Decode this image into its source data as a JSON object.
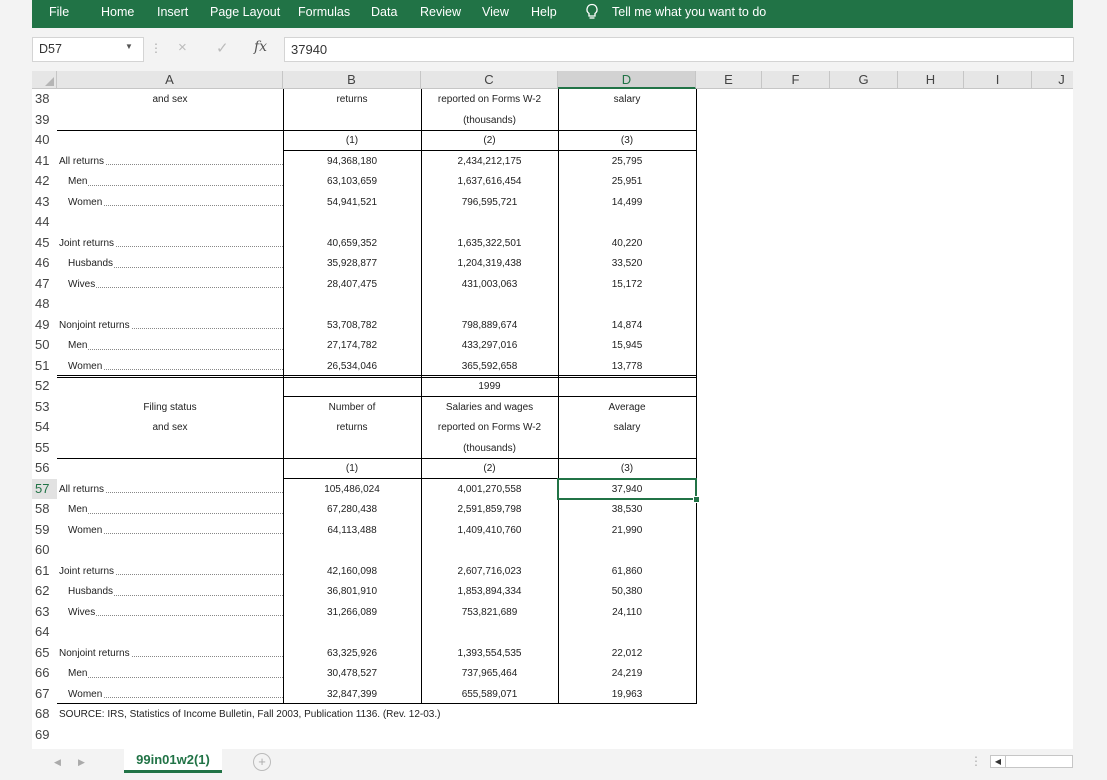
{
  "ribbon": {
    "tabs": [
      "File",
      "Home",
      "Insert",
      "Page Layout",
      "Formulas",
      "Data",
      "Review",
      "View",
      "Help"
    ],
    "tell_me": "Tell me what you want to do"
  },
  "formula_bar": {
    "name_box": "D57",
    "cancel_icon": "×",
    "enter_icon": "✓",
    "fx_label": "fx",
    "value": "37940"
  },
  "columns": [
    "A",
    "B",
    "C",
    "D",
    "E",
    "F",
    "G",
    "H",
    "I",
    "J"
  ],
  "selected_column": "D",
  "selected_row": "57",
  "rows": [
    {
      "n": "38",
      "a": "and sex",
      "b": "returns",
      "c": "reported on Forms W-2",
      "d": "salary"
    },
    {
      "n": "39",
      "a": "",
      "b": "",
      "c": "(thousands)",
      "d": ""
    },
    {
      "n": "40",
      "a": "",
      "b": "(1)",
      "c": "(2)",
      "d": "(3)"
    },
    {
      "n": "41",
      "a": "All returns",
      "b": "94,368,180",
      "c": "2,434,212,175",
      "d": "25,795"
    },
    {
      "n": "42",
      "a": "Men",
      "b": "63,103,659",
      "c": "1,637,616,454",
      "d": "25,951"
    },
    {
      "n": "43",
      "a": "Women",
      "b": "54,941,521",
      "c": "796,595,721",
      "d": "14,499"
    },
    {
      "n": "44",
      "a": "",
      "b": "",
      "c": "",
      "d": ""
    },
    {
      "n": "45",
      "a": "Joint returns",
      "b": "40,659,352",
      "c": "1,635,322,501",
      "d": "40,220"
    },
    {
      "n": "46",
      "a": "Husbands",
      "b": "35,928,877",
      "c": "1,204,319,438",
      "d": "33,520"
    },
    {
      "n": "47",
      "a": "Wives",
      "b": "28,407,475",
      "c": "431,003,063",
      "d": "15,172"
    },
    {
      "n": "48",
      "a": "",
      "b": "",
      "c": "",
      "d": ""
    },
    {
      "n": "49",
      "a": "Nonjoint returns",
      "b": "53,708,782",
      "c": "798,889,674",
      "d": "14,874"
    },
    {
      "n": "50",
      "a": "Men",
      "b": "27,174,782",
      "c": "433,297,016",
      "d": "15,945"
    },
    {
      "n": "51",
      "a": "Women",
      "b": "26,534,046",
      "c": "365,592,658",
      "d": "13,778"
    },
    {
      "n": "52",
      "a": "",
      "b": "",
      "c": "1999",
      "d": ""
    },
    {
      "n": "53",
      "a": "Filing status",
      "b": "Number of",
      "c": "Salaries and wages",
      "d": "Average"
    },
    {
      "n": "54",
      "a": "and sex",
      "b": "returns",
      "c": "reported on Forms W-2",
      "d": "salary"
    },
    {
      "n": "55",
      "a": "",
      "b": "",
      "c": "(thousands)",
      "d": ""
    },
    {
      "n": "56",
      "a": "",
      "b": "(1)",
      "c": "(2)",
      "d": "(3)"
    },
    {
      "n": "57",
      "a": "All returns",
      "b": "105,486,024",
      "c": "4,001,270,558",
      "d": "37,940"
    },
    {
      "n": "58",
      "a": "Men",
      "b": "67,280,438",
      "c": "2,591,859,798",
      "d": "38,530"
    },
    {
      "n": "59",
      "a": "Women",
      "b": "64,113,488",
      "c": "1,409,410,760",
      "d": "21,990"
    },
    {
      "n": "60",
      "a": "",
      "b": "",
      "c": "",
      "d": ""
    },
    {
      "n": "61",
      "a": "Joint returns",
      "b": "42,160,098",
      "c": "2,607,716,023",
      "d": "61,860"
    },
    {
      "n": "62",
      "a": "Husbands",
      "b": "36,801,910",
      "c": "1,853,894,334",
      "d": "50,380"
    },
    {
      "n": "63",
      "a": "Wives",
      "b": "31,266,089",
      "c": "753,821,689",
      "d": "24,110"
    },
    {
      "n": "64",
      "a": "",
      "b": "",
      "c": "",
      "d": ""
    },
    {
      "n": "65",
      "a": "Nonjoint returns",
      "b": "63,325,926",
      "c": "1,393,554,535",
      "d": "22,012"
    },
    {
      "n": "66",
      "a": "Men",
      "b": "30,478,527",
      "c": "737,965,464",
      "d": "24,219"
    },
    {
      "n": "67",
      "a": "Women",
      "b": "32,847,399",
      "c": "655,589,071",
      "d": "19,963"
    },
    {
      "n": "68",
      "src": "SOURCE: IRS, Statistics of Income Bulletin, Fall 2003, Publication 1136. (Rev. 12-03.)"
    },
    {
      "n": "69"
    }
  ],
  "sheet": {
    "active_tab": "99in01w2(1)",
    "add_label": "+"
  },
  "colors": {
    "accent": "#217346"
  }
}
